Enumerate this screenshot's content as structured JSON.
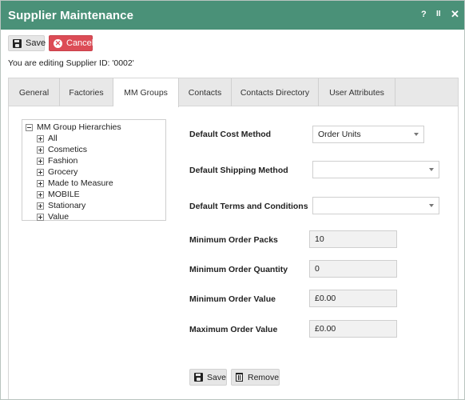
{
  "window": {
    "title": "Supplier Maintenance",
    "help_glyph": "?",
    "pause_glyph": "II",
    "close_glyph": "✕",
    "accent_color": "#4a9178"
  },
  "toolbar": {
    "save_label": "Save",
    "cancel_label": "Cancel",
    "cancel_color": "#dc4c56"
  },
  "editing_text": "You are editing Supplier ID: '0002'",
  "tabs": [
    {
      "label": "General",
      "active": false
    },
    {
      "label": "Factories",
      "active": false
    },
    {
      "label": "MM Groups",
      "active": true
    },
    {
      "label": "Contacts",
      "active": false
    },
    {
      "label": "Contacts Directory",
      "active": false
    },
    {
      "label": "User Attributes",
      "active": false
    }
  ],
  "tree": {
    "root": "MM Group Hierarchies",
    "items": [
      "All",
      "Cosmetics",
      "Fashion",
      "Grocery",
      "Made to Measure",
      "MOBILE",
      "Stationary",
      "Value"
    ]
  },
  "form": {
    "default_cost_method": {
      "label": "Default Cost Method",
      "value": "Order Units"
    },
    "default_shipping_method": {
      "label": "Default Shipping Method",
      "value": ""
    },
    "default_terms": {
      "label": "Default Terms and Conditions",
      "value": ""
    },
    "min_order_packs": {
      "label": "Minimum Order Packs",
      "value": "10"
    },
    "min_order_quantity": {
      "label": "Minimum Order Quantity",
      "value": "0"
    },
    "min_order_value": {
      "label": "Minimum Order Value",
      "value": "£0.00"
    },
    "max_order_value": {
      "label": "Maximum Order Value",
      "value": "£0.00"
    }
  },
  "bottom_buttons": {
    "save_label": "Save",
    "remove_label": "Remove"
  }
}
